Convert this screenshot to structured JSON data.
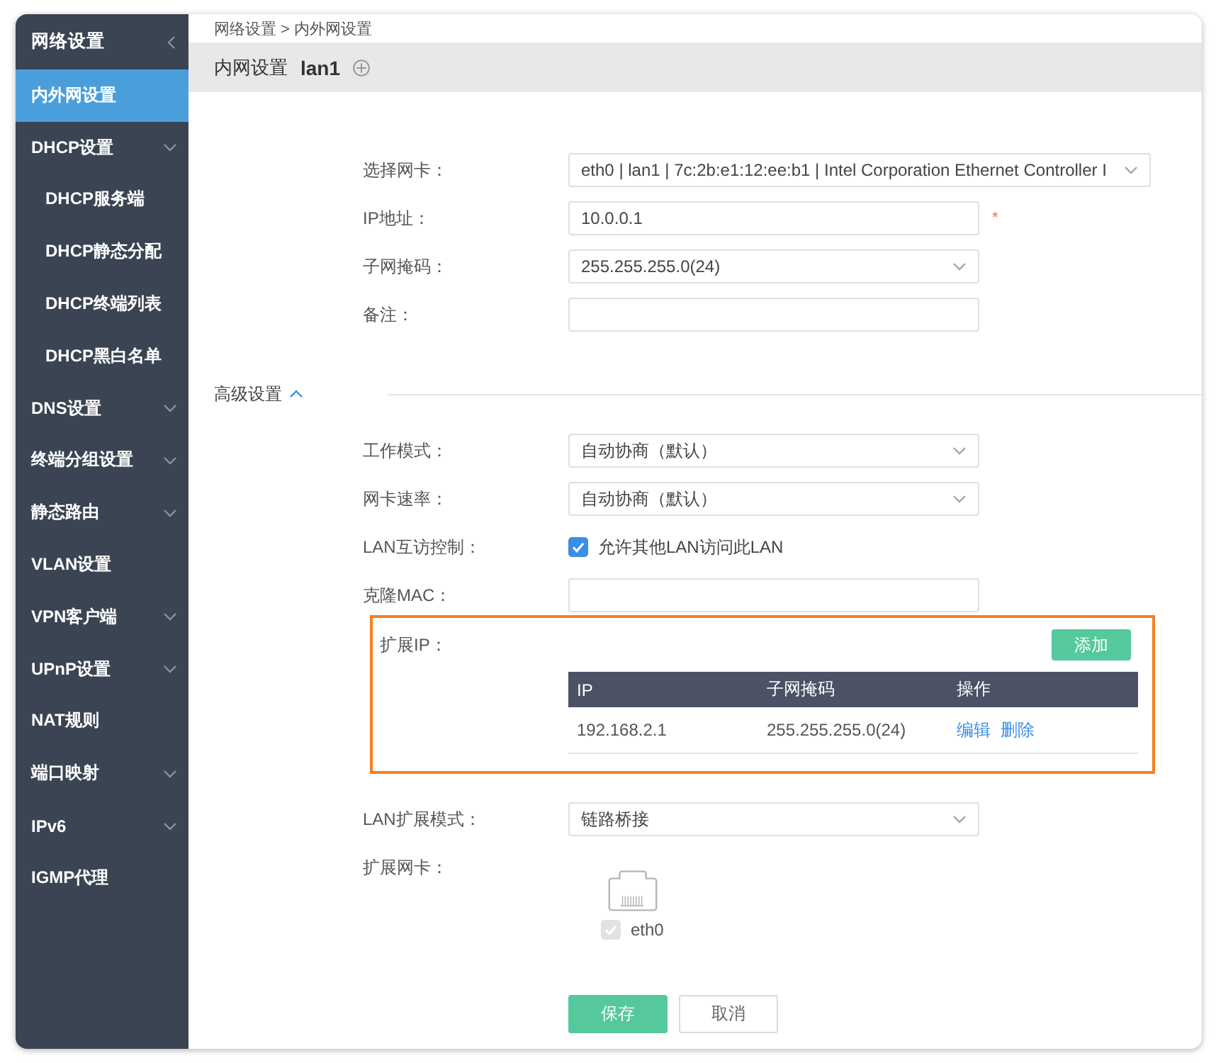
{
  "sidebar": {
    "title": "网络设置",
    "items": [
      {
        "label": "内外网设置",
        "kind": "link",
        "selected": true
      },
      {
        "label": "DHCP设置",
        "kind": "group",
        "selected": false,
        "children": [
          {
            "label": "DHCP服务端",
            "kind": "link",
            "selected": false
          },
          {
            "label": "DHCP静态分配",
            "kind": "link",
            "selected": false
          },
          {
            "label": "DHCP终端列表",
            "kind": "link",
            "selected": false
          },
          {
            "label": "DHCP黑白名单",
            "kind": "link",
            "selected": false
          }
        ]
      },
      {
        "label": "DNS设置",
        "kind": "group",
        "selected": false
      },
      {
        "label": "终端分组设置",
        "kind": "group",
        "selected": false
      },
      {
        "label": "静态路由",
        "kind": "group",
        "selected": false
      },
      {
        "label": "VLAN设置",
        "kind": "link",
        "selected": false
      },
      {
        "label": "VPN客户端",
        "kind": "group",
        "selected": false
      },
      {
        "label": "UPnP设置",
        "kind": "group",
        "selected": false
      },
      {
        "label": "NAT规则",
        "kind": "link",
        "selected": false
      },
      {
        "label": "端口映射",
        "kind": "group",
        "selected": false
      },
      {
        "label": "IPv6",
        "kind": "group",
        "selected": false
      },
      {
        "label": "IGMP代理",
        "kind": "link",
        "selected": false
      }
    ]
  },
  "breadcrumb": "网络设置 > 内外网设置",
  "header": {
    "title": "内网设置",
    "interface": "lan1"
  },
  "basic": {
    "fields": [
      {
        "label": "选择网卡：",
        "kind": "select",
        "value": "eth0 | lan1 | 7c:2b:e1:12:ee:b1 | Intel Corporation Ethernet Controller I"
      },
      {
        "label": "IP地址：",
        "kind": "input",
        "value": "10.0.0.1",
        "required_mark": "*"
      },
      {
        "label": "子网掩码：",
        "kind": "select",
        "value": "255.255.255.0(24)"
      },
      {
        "label": "备注：",
        "kind": "input"
      }
    ]
  },
  "advanced": {
    "title": "高级设置",
    "expanded": true,
    "fields": [
      {
        "label": "工作模式：",
        "kind": "select",
        "value": "自动协商（默认）"
      },
      {
        "label": "网卡速率：",
        "kind": "select",
        "value": "自动协商（默认）"
      },
      {
        "label": "LAN互访控制：",
        "kind": "checkbox",
        "checked": true,
        "text": "允许其他LAN访问此LAN"
      },
      {
        "label": "克隆MAC：",
        "kind": "input"
      }
    ]
  },
  "extended_ip": {
    "label": "扩展IP：",
    "highlighted": true,
    "add_button": "添加",
    "columns": [
      "IP",
      "子网掩码",
      "操作"
    ],
    "rows": [
      {
        "cells": [
          "192.168.2.1",
          "255.255.255.0(24)"
        ],
        "actions": [
          "编辑",
          "删除"
        ]
      }
    ]
  },
  "lan_extension_mode": {
    "label": "LAN扩展模式：",
    "kind": "select",
    "value": "链路桥接"
  },
  "extended_nic": {
    "label": "扩展网卡：",
    "ports": [
      {
        "name": "eth0",
        "checked": true,
        "disabled": true
      }
    ]
  },
  "buttons": [
    {
      "label": "保存",
      "kind": "primary"
    },
    {
      "label": "取消",
      "kind": "default"
    }
  ]
}
